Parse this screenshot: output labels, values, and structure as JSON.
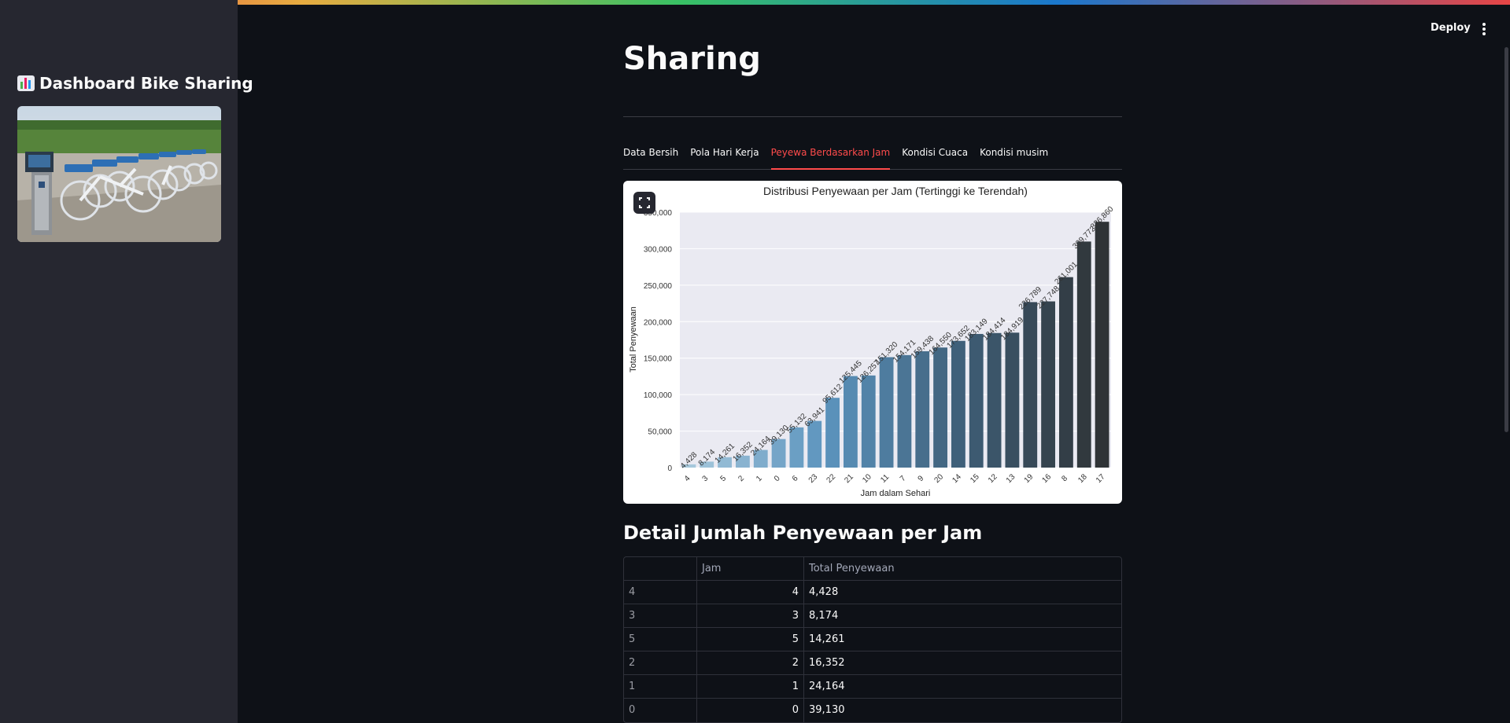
{
  "sidebar": {
    "title": "Dashboard Bike Sharing",
    "title_icon": "bar-chart-emoji",
    "image_alt": "bike-sharing-station-photo"
  },
  "header": {
    "deploy_label": "Deploy",
    "menu_icon": "kebab-menu-icon"
  },
  "main": {
    "title": "Sharing",
    "tabs": [
      {
        "label": "Data Bersih",
        "active": false
      },
      {
        "label": "Pola Hari Kerja",
        "active": false
      },
      {
        "label": "Peyewa Berdasarkan Jam",
        "active": true
      },
      {
        "label": "Kondisi Cuaca",
        "active": false
      },
      {
        "label": "Kondisi musim",
        "active": false
      }
    ],
    "section_title": "Detail Jumlah Penyewaan per Jam",
    "table": {
      "columns": [
        "",
        "Jam",
        "Total Penyewaan"
      ],
      "rows": [
        {
          "index": "4",
          "jam": "4",
          "total": "4,428"
        },
        {
          "index": "3",
          "jam": "3",
          "total": "8,174"
        },
        {
          "index": "5",
          "jam": "5",
          "total": "14,261"
        },
        {
          "index": "2",
          "jam": "2",
          "total": "16,352"
        },
        {
          "index": "1",
          "jam": "1",
          "total": "24,164"
        },
        {
          "index": "0",
          "jam": "0",
          "total": "39,130"
        }
      ]
    }
  },
  "chart_data": {
    "type": "bar",
    "title": "Distribusi Penyewaan per Jam (Tertinggi ke Terendah)",
    "xlabel": "Jam dalam Sehari",
    "ylabel": "Total Penyewaan",
    "ylim": [
      0,
      350000
    ],
    "yticks": [
      0,
      50000,
      100000,
      150000,
      200000,
      250000,
      300000,
      350000
    ],
    "ytick_labels": [
      "0",
      "50,000",
      "100,000",
      "150,000",
      "200,000",
      "250,000",
      "300,000",
      "350,000"
    ],
    "categories": [
      "4",
      "3",
      "5",
      "2",
      "1",
      "0",
      "6",
      "23",
      "22",
      "21",
      "10",
      "11",
      "7",
      "9",
      "20",
      "14",
      "15",
      "12",
      "13",
      "19",
      "16",
      "8",
      "18",
      "17"
    ],
    "values": [
      4428,
      8174,
      14261,
      16352,
      24164,
      39130,
      55132,
      63941,
      95612,
      125445,
      126257,
      151320,
      154171,
      159438,
      164550,
      173652,
      183149,
      184414,
      184919,
      226789,
      227748,
      261001,
      309772,
      336860
    ],
    "value_labels": [
      "4,428",
      "8,174",
      "14,261",
      "16,352",
      "24,164",
      "39,130",
      "55,132",
      "63,941",
      "95,612",
      "125,445",
      "126,257",
      "151,320",
      "154,171",
      "159,438",
      "164,550",
      "173,652",
      "183,149",
      "184,414",
      "184,919",
      "226,789",
      "227,748",
      "261,001",
      "309,772",
      "336,860"
    ],
    "grid": true,
    "palette": [
      "#a6c8dc",
      "#5b93bd",
      "#3e5e77",
      "#2f3336"
    ]
  }
}
